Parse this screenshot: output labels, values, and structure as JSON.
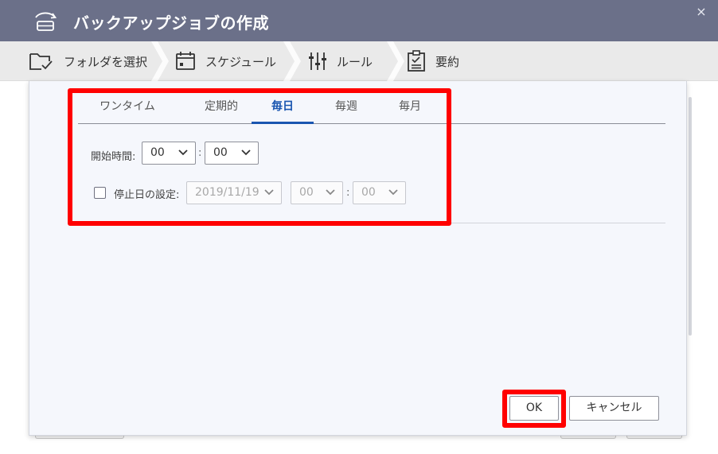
{
  "window": {
    "title": "バックアップジョブの作成",
    "close_symbol": "×"
  },
  "steps": [
    {
      "label": "フォルダを選択",
      "icon": "folder-check-icon"
    },
    {
      "label": "スケジュール",
      "icon": "calendar-icon"
    },
    {
      "label": "ルール",
      "icon": "sliders-icon"
    },
    {
      "label": "要約",
      "icon": "clipboard-icon"
    }
  ],
  "schedule": {
    "tabs": [
      "ワンタイム",
      "定期的",
      "毎日",
      "毎週",
      "毎月"
    ],
    "active_tab": "毎日",
    "start_time": {
      "label": "開始時間:",
      "hour": "00",
      "separator": ":",
      "minute": "00"
    },
    "end_date": {
      "checkbox_checked": false,
      "label": "停止日の設定:",
      "date": "2019/11/19",
      "hour": "00",
      "separator": ":",
      "minute": "00"
    }
  },
  "buttons": {
    "ok": "OK",
    "cancel": "キャンセル"
  },
  "colors": {
    "title_bar": "#6b7089",
    "accent": "#1a56b0",
    "highlight": "#ff0000"
  }
}
